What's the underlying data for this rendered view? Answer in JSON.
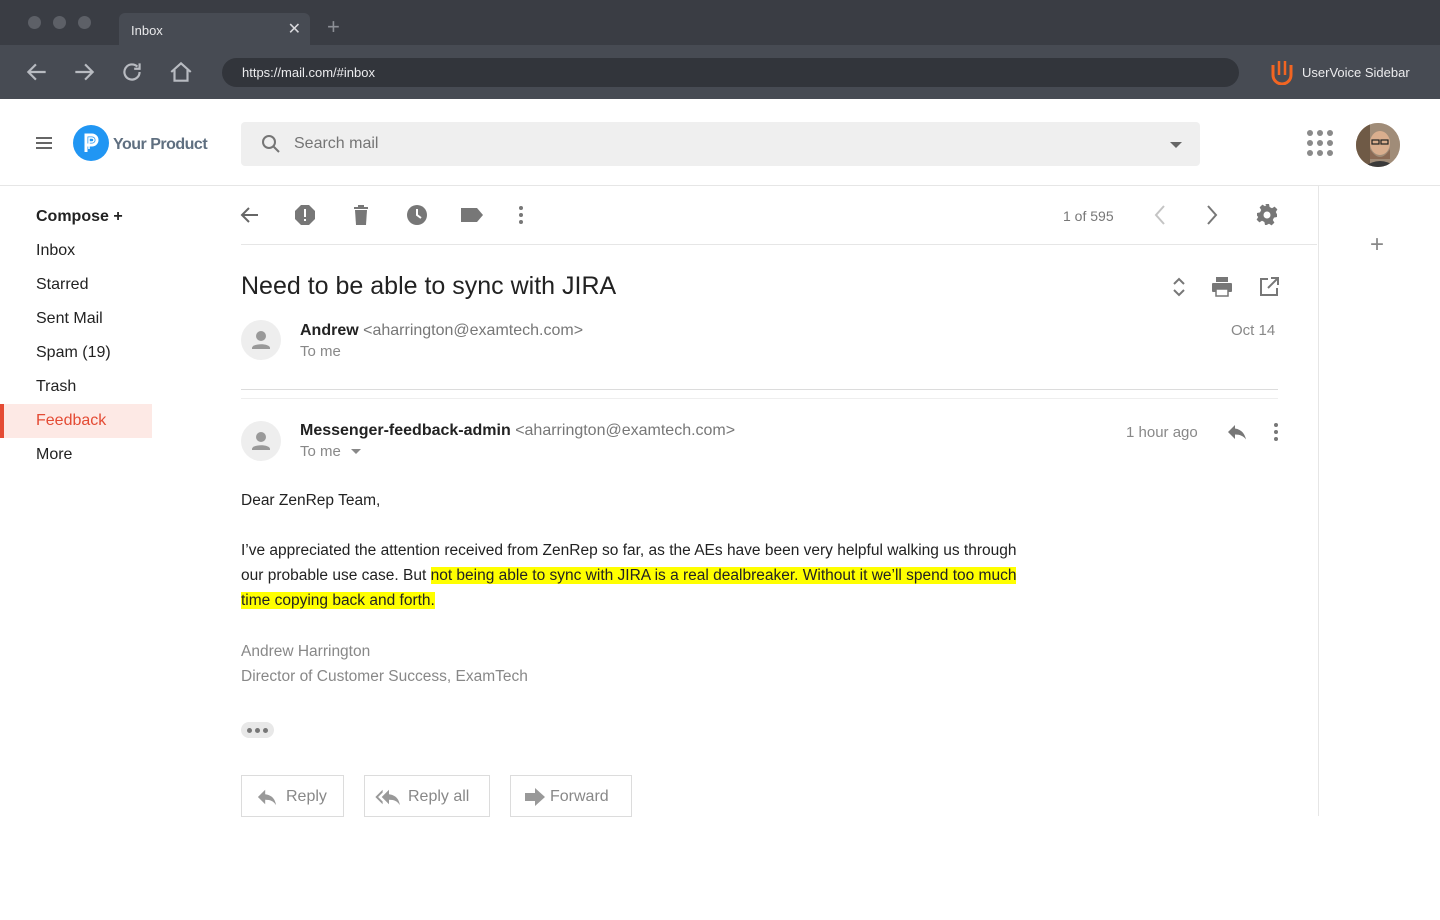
{
  "browser": {
    "tab_title": "Inbox",
    "tab_close": "✕",
    "new_tab": "+",
    "url": "https://mail.com/#inbox",
    "extension_label": "UserVoice Sidebar"
  },
  "header": {
    "logo_text": "Your Product",
    "search_placeholder": "Search mail"
  },
  "sidebar": {
    "items": [
      {
        "label": "Compose +"
      },
      {
        "label": "Inbox"
      },
      {
        "label": "Starred"
      },
      {
        "label": "Sent Mail"
      },
      {
        "label": "Spam (19)"
      },
      {
        "label": "Trash"
      },
      {
        "label": "Feedback"
      },
      {
        "label": "More"
      }
    ]
  },
  "toolbar": {
    "count": "1 of 595"
  },
  "thread": {
    "subject": "Need to be able to sync with JIRA",
    "messages": [
      {
        "sender_name": "Andrew",
        "sender_email": "<aharrington@examtech.com>",
        "to": "To me",
        "date": "Oct 14"
      },
      {
        "sender_name": "Messenger-feedback-admin",
        "sender_email": "<aharrington@examtech.com>",
        "to": "To me",
        "date": "1 hour ago"
      }
    ],
    "body": {
      "greeting": "Dear ZenRep Team,",
      "paragraph_plain": "I’ve appreciated the attention received from ZenRep so far, as the AEs have been very helpful walking us through our probable use case. But ",
      "paragraph_highlight": "not being able to sync with JIRA is a real dealbreaker. Without it we’ll spend too much time copying back and forth."
    },
    "signature": {
      "name": "Andrew Harrington",
      "title": "Director of Customer Success, ExamTech"
    }
  },
  "actions": {
    "reply": "Reply",
    "reply_all": "Reply all",
    "forward": "Forward"
  },
  "side_panel": {
    "add": "+"
  },
  "colors": {
    "accent": "#e44b34",
    "highlight": "#ffff00",
    "brand_blue": "#2196f3",
    "uservoice_orange": "#f26522"
  }
}
